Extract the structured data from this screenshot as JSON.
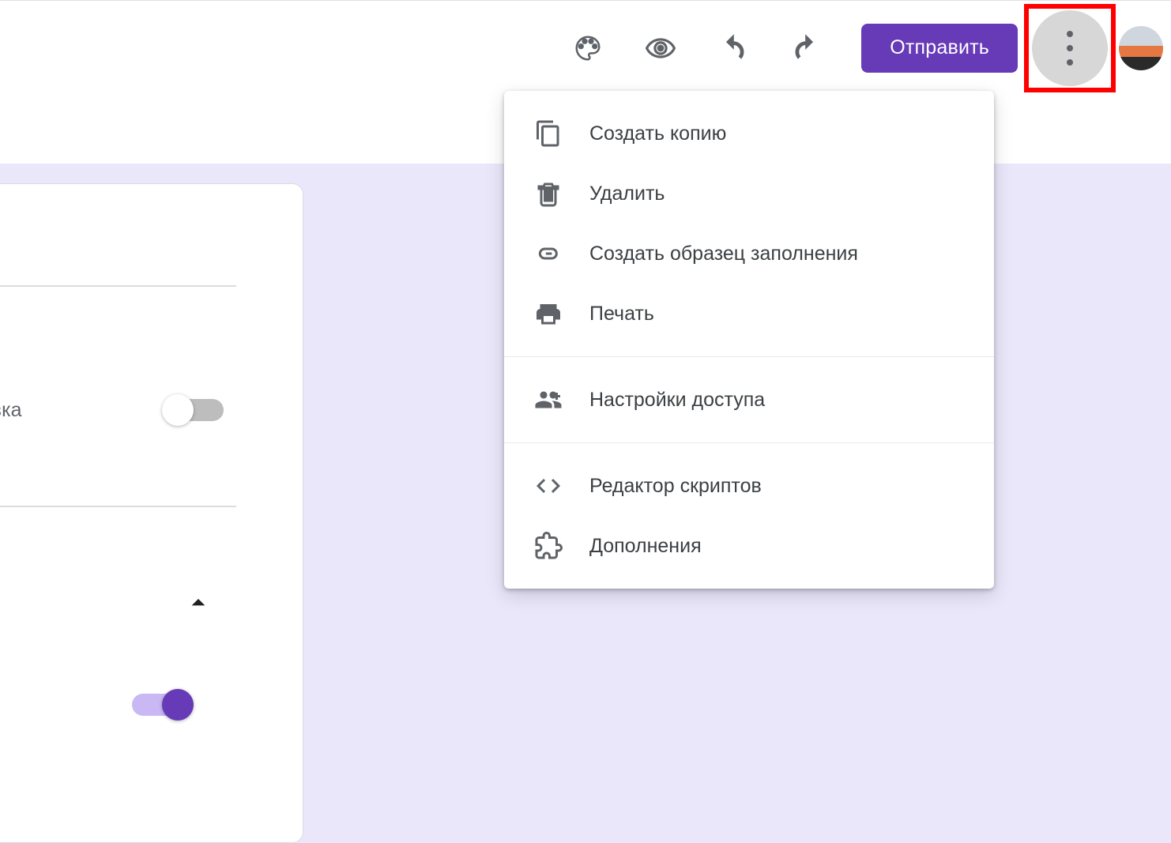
{
  "toolbar": {
    "send_label": "Отправить"
  },
  "card": {
    "row_label_fragment": "равка"
  },
  "menu": {
    "items": [
      {
        "icon": "copy-icon",
        "label": "Создать копию"
      },
      {
        "icon": "trash-icon",
        "label": "Удалить"
      },
      {
        "icon": "link-icon",
        "label": "Создать образец заполнения"
      },
      {
        "icon": "print-icon",
        "label": "Печать"
      }
    ],
    "items2": [
      {
        "icon": "people-icon",
        "label": "Настройки доступа"
      }
    ],
    "items3": [
      {
        "icon": "code-icon",
        "label": "Редактор скриптов"
      },
      {
        "icon": "puzzle-icon",
        "label": "Дополнения"
      }
    ]
  },
  "colors": {
    "accent": "#673ab7",
    "highlight": "#ff0000"
  }
}
